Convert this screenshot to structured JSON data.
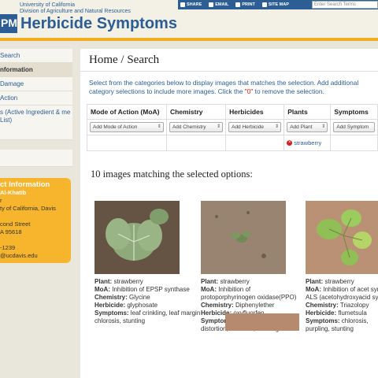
{
  "header": {
    "uc_line1": "University of California",
    "uc_line2": "Division of Agriculture and Natural Resources",
    "logo_text": "PM",
    "site_title": "Herbicide Symptoms",
    "top_links": [
      "SHARE",
      "EMAIL",
      "PRINT",
      "SITE MAP"
    ],
    "search_placeholder": "Enter Search Terms",
    "brand_color": "#2c5e93",
    "accent_color": "#f2ad1f"
  },
  "sidebar": {
    "items": [
      {
        "label": "Search"
      },
      {
        "label": "nformation"
      },
      {
        "label": " Damage"
      },
      {
        "label": "Action"
      },
      {
        "label": "s (Active Ingredient & me List)"
      }
    ],
    "contact": {
      "title": "ct Information",
      "name": "Al-Khatib",
      "line1": "r",
      "line2": "ty of California, Davis",
      "line3": "cond Street",
      "line4": "A 95618",
      "line5": "-1239",
      "line6": "@ucdavis.edu"
    }
  },
  "main": {
    "page_title": "Home / Search",
    "instructions_1": "Select from the categories below to display images that matches the selection. Add additional",
    "instructions_2a": "category selections to include more images. Click the ",
    "instructions_red": "\"0\"",
    "instructions_2b": " to remove the selection.",
    "filters": {
      "columns": [
        "Mode of Action (MoA)",
        "Chemistry",
        "Herbicides",
        "Plants",
        "Symptoms"
      ],
      "selects": [
        "Add Mode of Action",
        "Add Chemistry",
        "Add Herbicide",
        "Add Plant",
        "Add Symptom"
      ],
      "selected_plant": "strawberry"
    },
    "result_count": "10 images matching the selected options:",
    "labels": {
      "plant": "Plant:",
      "moa": "MoA:",
      "chemistry": "Chemistry:",
      "herbicide": "Herbicide:",
      "symptoms": "Symptoms:"
    },
    "results": [
      {
        "plant": "strawberry",
        "moa": "Inhibition of EPSP synthase",
        "chemistry": "Glycine",
        "herbicide": "glyphosate",
        "symptoms": "leaf crinkling, leaf margin chlorosis, stunting"
      },
      {
        "plant": "strawberry",
        "moa": "Inhibition of protoporphyrinogen oxidase(PPO)",
        "chemistry": "Diphenylether",
        "herbicide": "oxyfluorfen",
        "symptoms": "leaf crinkling, leaf distortion, necrosis, stunting"
      },
      {
        "plant": "strawberry",
        "moa": "Inhibition of acet synthase ALS (acetohydroxyacid synt AHAS)",
        "chemistry": "Triazolopy",
        "herbicide": "flumetsula",
        "symptoms": "chlorosis, purpling, stunting"
      }
    ]
  }
}
